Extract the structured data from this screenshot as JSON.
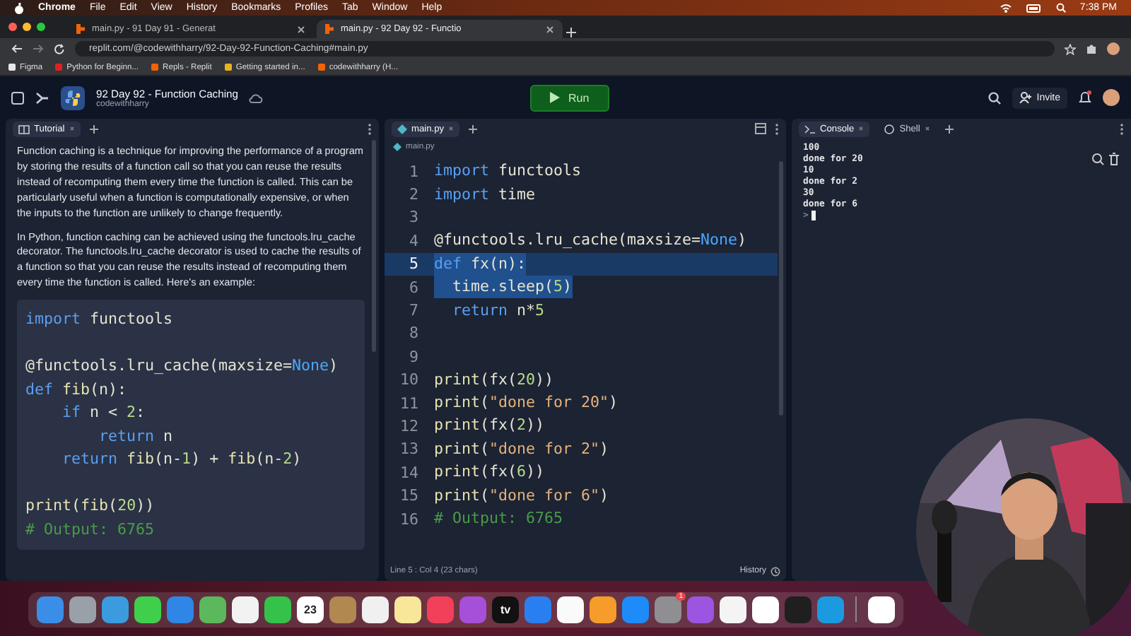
{
  "menu_bar": {
    "app": "Chrome",
    "menus": [
      "File",
      "Edit",
      "View",
      "History",
      "Bookmarks",
      "Profiles",
      "Tab",
      "Window",
      "Help"
    ],
    "clock": "7:38 PM"
  },
  "browser_tabs": [
    {
      "title": "main.py - 91 Day 91 - Generat",
      "selected": false
    },
    {
      "title": "main.py - 92 Day 92 - Functio",
      "selected": true
    }
  ],
  "address": "replit.com/@codewithharry/92-Day-92-Function-Caching#main.py",
  "bookmarks": [
    {
      "label": "Figma",
      "color": "#e8e8e8"
    },
    {
      "label": "Python for Beginn...",
      "color": "#e02020"
    },
    {
      "label": "Repls - Replit",
      "color": "#f26207"
    },
    {
      "label": "Getting started in...",
      "color": "#e6b422"
    },
    {
      "label": "codewithharry (H...",
      "color": "#f26207"
    }
  ],
  "repl": {
    "title": "92 Day 92 - Function Caching",
    "owner": "codewithharry",
    "run": "Run",
    "invite": "Invite"
  },
  "tutorial": {
    "tab": "Tutorial",
    "paragraphs": [
      "Function caching is a technique for improving the performance of a program by storing the results of a function call so that you can reuse the results instead of recomputing them every time the function is called. This can be particularly useful when a function is computationally expensive, or when the inputs to the function are unlikely to change frequently.",
      "In Python, function caching can be achieved using the functools.lru_cache decorator. The functools.lru_cache decorator is used to cache the results of a function so that you can reuse the results instead of recomputing them every time the function is called. Here's an example:"
    ],
    "code": [
      {
        "tokens": [
          {
            "kind": "kw",
            "text": "import"
          },
          {
            "kind": "plain",
            "text": " functools"
          }
        ]
      },
      {
        "space_before": true,
        "tokens": [
          {
            "kind": "plain",
            "text": "@functools.lru_cache(maxsize="
          },
          {
            "kind": "const",
            "text": "None"
          },
          {
            "kind": "plain",
            "text": ")"
          }
        ]
      },
      {
        "tokens": [
          {
            "kind": "kw",
            "text": "def"
          },
          {
            "kind": "fn",
            "text": " fib"
          },
          {
            "kind": "plain",
            "text": "(n):"
          }
        ]
      },
      {
        "tokens": [
          {
            "kind": "kw",
            "text": "    if"
          },
          {
            "kind": "plain",
            "text": " n < "
          },
          {
            "kind": "num",
            "text": "2"
          },
          {
            "kind": "plain",
            "text": ":"
          }
        ]
      },
      {
        "tokens": [
          {
            "kind": "kw",
            "text": "        return"
          },
          {
            "kind": "plain",
            "text": " n"
          }
        ]
      },
      {
        "tokens": [
          {
            "kind": "kw",
            "text": "    return"
          },
          {
            "kind": "fn",
            "text": " fib"
          },
          {
            "kind": "plain",
            "text": "(n-"
          },
          {
            "kind": "num",
            "text": "1"
          },
          {
            "kind": "plain",
            "text": ") + "
          },
          {
            "kind": "fn",
            "text": "fib"
          },
          {
            "kind": "plain",
            "text": "(n-"
          },
          {
            "kind": "num",
            "text": "2"
          },
          {
            "kind": "plain",
            "text": ")"
          }
        ]
      },
      {
        "space_before": true,
        "tokens": [
          {
            "kind": "fn",
            "text": "print"
          },
          {
            "kind": "plain",
            "text": "("
          },
          {
            "kind": "fn",
            "text": "fib"
          },
          {
            "kind": "plain",
            "text": "("
          },
          {
            "kind": "num",
            "text": "20"
          },
          {
            "kind": "plain",
            "text": "))"
          }
        ]
      },
      {
        "tokens": [
          {
            "kind": "com",
            "text": "# Output: 6765"
          }
        ]
      }
    ]
  },
  "editor": {
    "tab": "main.py",
    "breadcrumb": "main.py",
    "status": "Line 5 : Col 4 (23 chars)",
    "history": "History",
    "lines": [
      {
        "number": "1",
        "active": false,
        "selected": false,
        "tokens": [
          {
            "kind": "kw",
            "text": "import"
          },
          {
            "kind": "plain",
            "text": " functools"
          }
        ]
      },
      {
        "number": "2",
        "active": false,
        "selected": false,
        "tokens": [
          {
            "kind": "kw",
            "text": "import"
          },
          {
            "kind": "plain",
            "text": " time"
          }
        ]
      },
      {
        "number": "3",
        "active": false,
        "selected": false
      },
      {
        "number": "4",
        "active": false,
        "selected": false,
        "tokens": [
          {
            "kind": "plain",
            "text": "@functools.lru_cache(maxsize="
          },
          {
            "kind": "const",
            "text": "None"
          },
          {
            "kind": "plain",
            "text": ")"
          }
        ]
      },
      {
        "number": "5",
        "active": true,
        "selected": true,
        "tokens": [
          {
            "kind": "kw",
            "text": "def"
          },
          {
            "kind": "plain",
            "text": " fx(n):"
          }
        ]
      },
      {
        "number": "6",
        "active": false,
        "selected": true,
        "tokens": [
          {
            "kind": "plain",
            "text": "  time.sleep("
          },
          {
            "kind": "num",
            "text": "5"
          },
          {
            "kind": "plain",
            "text": ")"
          }
        ]
      },
      {
        "number": "7",
        "active": false,
        "selected": false,
        "tokens": [
          {
            "kind": "kw",
            "text": "  return"
          },
          {
            "kind": "plain",
            "text": " n*"
          },
          {
            "kind": "num",
            "text": "5"
          }
        ]
      },
      {
        "number": "8",
        "active": false,
        "selected": false
      },
      {
        "number": "9",
        "active": false,
        "selected": false
      },
      {
        "number": "10",
        "active": false,
        "selected": false,
        "tokens": [
          {
            "kind": "fn",
            "text": "print"
          },
          {
            "kind": "plain",
            "text": "(fx("
          },
          {
            "kind": "num",
            "text": "20"
          },
          {
            "kind": "plain",
            "text": "))"
          }
        ]
      },
      {
        "number": "11",
        "active": false,
        "selected": false,
        "tokens": [
          {
            "kind": "fn",
            "text": "print"
          },
          {
            "kind": "plain",
            "text": "("
          },
          {
            "kind": "str",
            "text": "\"done for 20\""
          },
          {
            "kind": "plain",
            "text": ")"
          }
        ]
      },
      {
        "number": "12",
        "active": false,
        "selected": false,
        "tokens": [
          {
            "kind": "fn",
            "text": "print"
          },
          {
            "kind": "plain",
            "text": "(fx("
          },
          {
            "kind": "num",
            "text": "2"
          },
          {
            "kind": "plain",
            "text": "))"
          }
        ]
      },
      {
        "number": "13",
        "active": false,
        "selected": false,
        "tokens": [
          {
            "kind": "fn",
            "text": "print"
          },
          {
            "kind": "plain",
            "text": "("
          },
          {
            "kind": "str",
            "text": "\"done for 2\""
          },
          {
            "kind": "plain",
            "text": ")"
          }
        ]
      },
      {
        "number": "14",
        "active": false,
        "selected": false,
        "tokens": [
          {
            "kind": "fn",
            "text": "print"
          },
          {
            "kind": "plain",
            "text": "(fx("
          },
          {
            "kind": "num",
            "text": "6"
          },
          {
            "kind": "plain",
            "text": "))"
          }
        ]
      },
      {
        "number": "15",
        "active": false,
        "selected": false,
        "tokens": [
          {
            "kind": "fn",
            "text": "print"
          },
          {
            "kind": "plain",
            "text": "("
          },
          {
            "kind": "str",
            "text": "\"done for 6\""
          },
          {
            "kind": "plain",
            "text": ")"
          }
        ]
      },
      {
        "number": "16",
        "active": false,
        "selected": false,
        "tokens": [
          {
            "kind": "com",
            "text": "# Output: 6765"
          }
        ]
      }
    ]
  },
  "console": {
    "tabs": [
      {
        "label": "Console",
        "selected": true
      },
      {
        "label": "Shell",
        "selected": false
      }
    ],
    "output": [
      "100",
      "done for 20",
      "10",
      "done for 2",
      "30",
      "done for 6"
    ],
    "prompt": ">"
  },
  "dock": [
    {
      "color": "#3b8ee8"
    },
    {
      "color": "#9aa0a8"
    },
    {
      "color": "#3a9bde"
    },
    {
      "color": "#3fcf4c"
    },
    {
      "color": "#2f86e6"
    },
    {
      "color": "#5cb85c"
    },
    {
      "color": "#f2f2f2"
    },
    {
      "color": "#35c24a"
    },
    {
      "color": "#ffffff",
      "label": "23"
    },
    {
      "color": "#b08850"
    },
    {
      "color": "#f0f0f0"
    },
    {
      "color": "#f8e79a"
    },
    {
      "color": "#f2405a"
    },
    {
      "color": "#a64fd8"
    },
    {
      "color": "#111111",
      "label": "tv"
    },
    {
      "color": "#2a7ff0"
    },
    {
      "color": "#fafafa"
    },
    {
      "color": "#f59c2a"
    },
    {
      "color": "#1d8cf8"
    },
    {
      "color": "#8e8e93",
      "badge": "1"
    },
    {
      "color": "#9b55e0"
    },
    {
      "color": "#f4f4f4"
    },
    {
      "color": "#ffffff"
    },
    {
      "color": "#1f1f1f"
    },
    {
      "color": "#1b9ae0"
    },
    {
      "color": "#ffffff"
    }
  ]
}
